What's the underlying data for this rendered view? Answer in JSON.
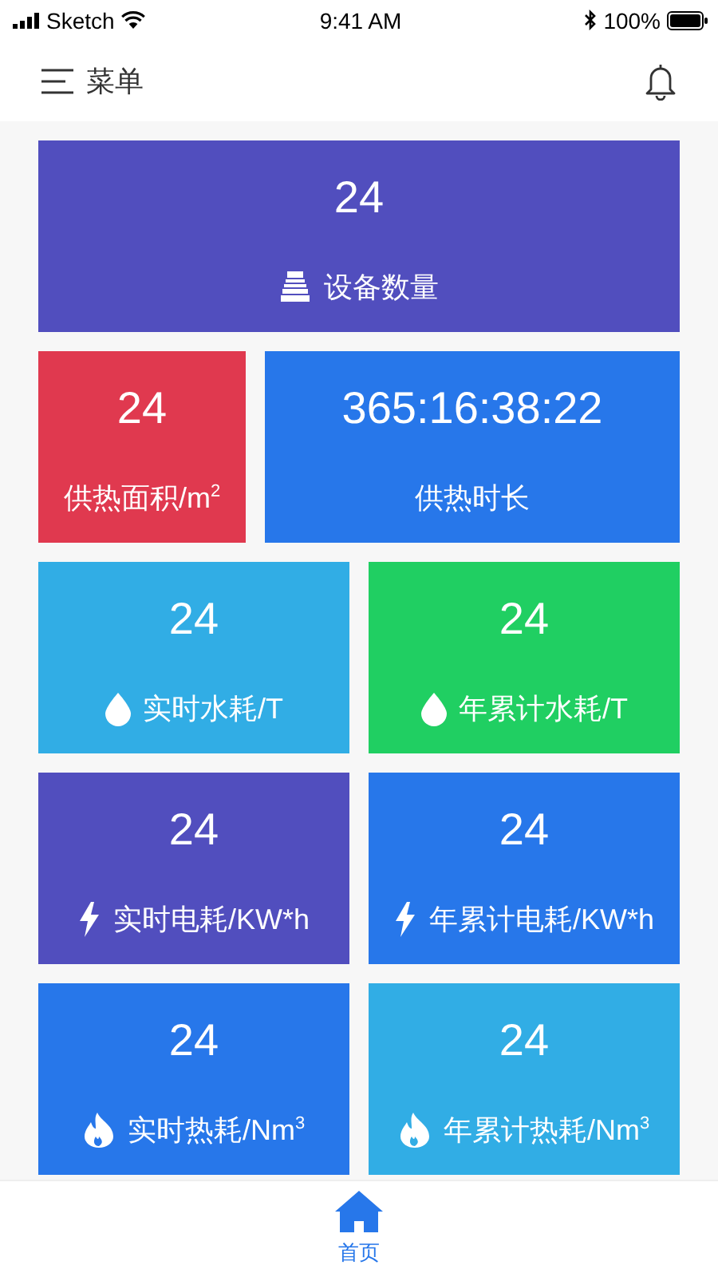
{
  "status_bar": {
    "carrier": "Sketch",
    "time": "9:41 AM",
    "battery": "100%"
  },
  "header": {
    "menu_label": "菜单"
  },
  "rows": [
    {
      "tiles": [
        {
          "value": "24",
          "label": "设备数量",
          "kind": "device",
          "color": "#514ebe"
        }
      ]
    },
    {
      "tiles": [
        {
          "value": "24",
          "label": "供热面积/m$^{2}$",
          "kind": "plain",
          "color": "#e0394f"
        },
        {
          "value": "365:16:38:22",
          "label": "供热时长",
          "kind": "plain",
          "color": "#2777ea"
        }
      ]
    },
    {
      "tiles": [
        {
          "value": "24",
          "label": "实时水耗/T",
          "kind": "water",
          "color": "#31ade5"
        },
        {
          "value": "24",
          "label": "年累计水耗/T",
          "kind": "water",
          "color": "#20cf62"
        }
      ]
    },
    {
      "tiles": [
        {
          "value": "24",
          "label": "实时电耗/KW*h",
          "kind": "power",
          "color": "#514ebe"
        },
        {
          "value": "24",
          "label": "年累计电耗/KW*h",
          "kind": "power",
          "color": "#2777ea"
        }
      ]
    },
    {
      "tiles": [
        {
          "value": "24",
          "label": "实时热耗/Nm$^{3}$",
          "kind": "heat",
          "color": "#2777ea"
        },
        {
          "value": "24",
          "label": "年累计热耗/Nm$^{3}$",
          "kind": "heat",
          "color": "#31ade5"
        }
      ]
    }
  ],
  "tab_bar": [
    {
      "label": "首页",
      "selected": true
    }
  ]
}
